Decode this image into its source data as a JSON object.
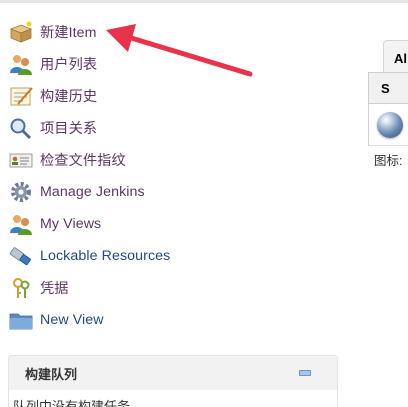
{
  "tasks": [
    {
      "label": "新建Item",
      "icon": "new-item-box-icon"
    },
    {
      "label": "用户列表",
      "icon": "users-icon"
    },
    {
      "label": "构建历史",
      "icon": "notepad-history-icon"
    },
    {
      "label": "项目关系",
      "icon": "magnifier-icon"
    },
    {
      "label": "检查文件指纹",
      "icon": "fingerprint-card-icon"
    },
    {
      "label": "Manage Jenkins",
      "icon": "gear-icon"
    },
    {
      "label": "My Views",
      "icon": "users-icon"
    },
    {
      "label": "Lockable Resources",
      "icon": "usb-lock-icon"
    },
    {
      "label": "凭据",
      "icon": "keys-icon"
    },
    {
      "label": "New View",
      "icon": "folder-icon"
    }
  ],
  "queue": {
    "title": "构建队列",
    "empty_text": "队列中没有构建任务"
  },
  "view": {
    "tab_all": "Al",
    "status_col": "S",
    "legend_prefix": "图标:"
  },
  "colors": {
    "link": "#204a87",
    "visited": "#5c3566",
    "annotation_arrow": "#e8334a"
  }
}
